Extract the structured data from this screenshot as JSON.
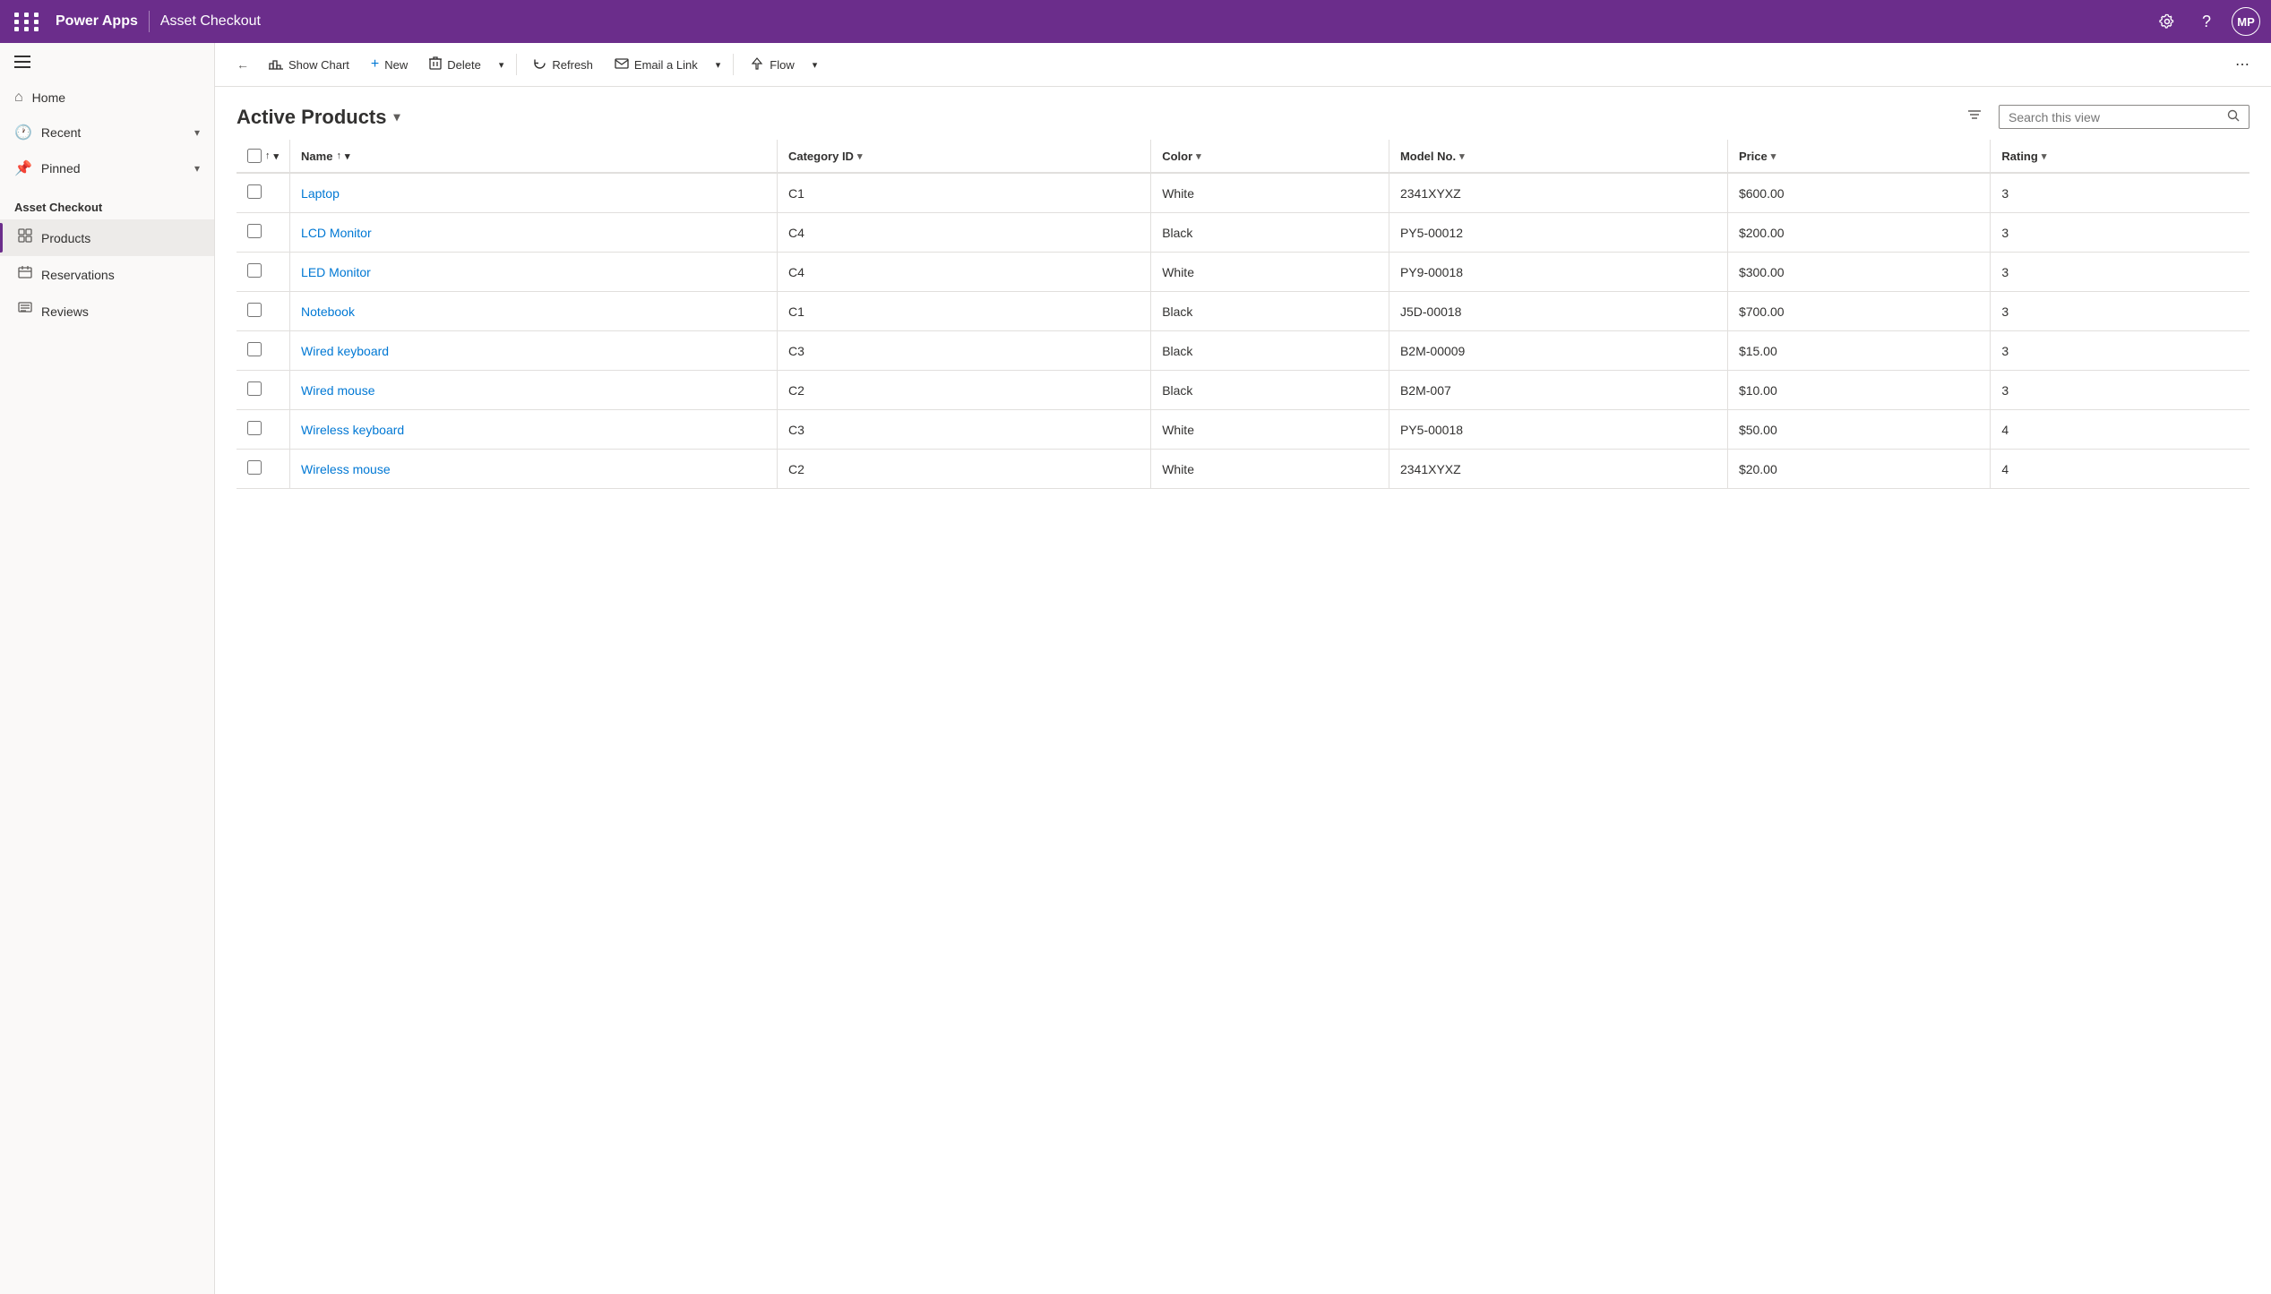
{
  "app": {
    "grid_label": "App grid",
    "logo": "Power Apps",
    "divider": "",
    "app_name": "Asset Checkout",
    "settings_label": "Settings",
    "help_label": "Help",
    "avatar": "MP"
  },
  "sidebar": {
    "hamburger_label": "Menu",
    "home_label": "Home",
    "recent_label": "Recent",
    "pinned_label": "Pinned",
    "section_title": "Asset Checkout",
    "items": [
      {
        "id": "products",
        "label": "Products",
        "icon": "📋",
        "active": true
      },
      {
        "id": "reservations",
        "label": "Reservations",
        "icon": "📅",
        "active": false
      },
      {
        "id": "reviews",
        "label": "Reviews",
        "icon": "📝",
        "active": false
      }
    ]
  },
  "toolbar": {
    "back_label": "Back",
    "show_chart_label": "Show Chart",
    "new_label": "New",
    "delete_label": "Delete",
    "refresh_label": "Refresh",
    "email_link_label": "Email a Link",
    "flow_label": "Flow",
    "more_label": "More options"
  },
  "view": {
    "title": "Active Products",
    "filter_label": "Filter",
    "search_placeholder": "Search this view"
  },
  "table": {
    "columns": [
      {
        "id": "name",
        "label": "Name",
        "sortable": true,
        "sort_dir": "asc"
      },
      {
        "id": "category_id",
        "label": "Category ID",
        "sortable": true
      },
      {
        "id": "color",
        "label": "Color",
        "sortable": true
      },
      {
        "id": "model_no",
        "label": "Model No.",
        "sortable": true
      },
      {
        "id": "price",
        "label": "Price",
        "sortable": true
      },
      {
        "id": "rating",
        "label": "Rating",
        "sortable": true
      }
    ],
    "rows": [
      {
        "name": "Laptop",
        "category_id": "C1",
        "color": "White",
        "model_no": "2341XYXZ",
        "price": "$600.00",
        "rating": "3"
      },
      {
        "name": "LCD Monitor",
        "category_id": "C4",
        "color": "Black",
        "model_no": "PY5-00012",
        "price": "$200.00",
        "rating": "3"
      },
      {
        "name": "LED Monitor",
        "category_id": "C4",
        "color": "White",
        "model_no": "PY9-00018",
        "price": "$300.00",
        "rating": "3"
      },
      {
        "name": "Notebook",
        "category_id": "C1",
        "color": "Black",
        "model_no": "J5D-00018",
        "price": "$700.00",
        "rating": "3"
      },
      {
        "name": "Wired keyboard",
        "category_id": "C3",
        "color": "Black",
        "model_no": "B2M-00009",
        "price": "$15.00",
        "rating": "3"
      },
      {
        "name": "Wired mouse",
        "category_id": "C2",
        "color": "Black",
        "model_no": "B2M-007",
        "price": "$10.00",
        "rating": "3"
      },
      {
        "name": "Wireless keyboard",
        "category_id": "C3",
        "color": "White",
        "model_no": "PY5-00018",
        "price": "$50.00",
        "rating": "4"
      },
      {
        "name": "Wireless mouse",
        "category_id": "C2",
        "color": "White",
        "model_no": "2341XYXZ",
        "price": "$20.00",
        "rating": "4"
      }
    ]
  }
}
